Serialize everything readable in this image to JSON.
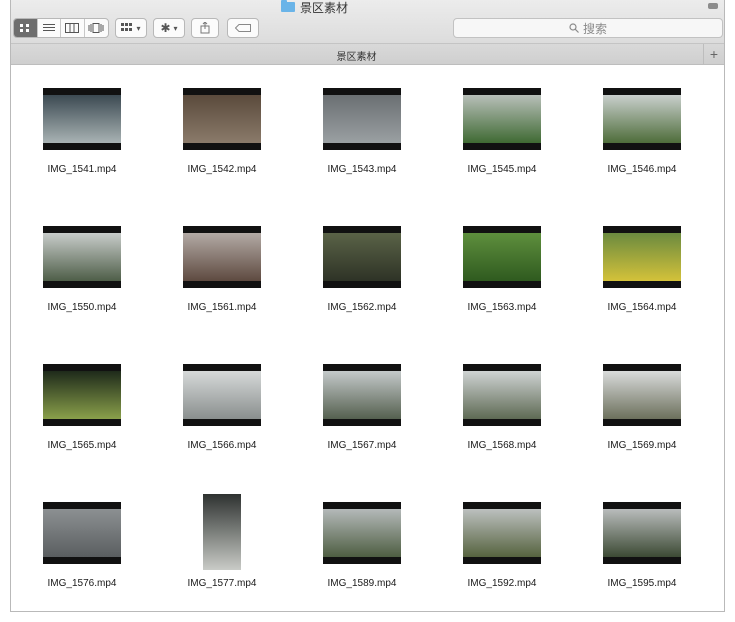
{
  "window": {
    "title": "景区素材",
    "tab_label": "景区素材",
    "search_placeholder": "搜索"
  },
  "toolbar": {
    "view_buttons": [
      "icon-view",
      "list-view",
      "column-view",
      "cover-flow-view"
    ],
    "arrange_icon": "grid-icon",
    "action_icon": "gear-icon",
    "share_icon": "share-icon",
    "tag_icon": "tag-icon"
  },
  "files": [
    {
      "name": "IMG_1541.mp4",
      "c1": "#3c4a52",
      "c2": "#a9b3b4",
      "shape": "wide"
    },
    {
      "name": "IMG_1542.mp4",
      "c1": "#5a4a3c",
      "c2": "#8a7a6a",
      "shape": "wide"
    },
    {
      "name": "IMG_1543.mp4",
      "c1": "#6a6f72",
      "c2": "#9aa0a2",
      "shape": "wide"
    },
    {
      "name": "IMG_1545.mp4",
      "c1": "#b8bfb9",
      "c2": "#3f6a33",
      "shape": "wide"
    },
    {
      "name": "IMG_1546.mp4",
      "c1": "#c9cfcd",
      "c2": "#4e6d3a",
      "shape": "wide"
    },
    {
      "name": "IMG_1550.mp4",
      "c1": "#c8ccca",
      "c2": "#4e5e48",
      "shape": "wide"
    },
    {
      "name": "IMG_1561.mp4",
      "c1": "#b3aaa5",
      "c2": "#5e4a40",
      "shape": "wide"
    },
    {
      "name": "IMG_1562.mp4",
      "c1": "#5a6347",
      "c2": "#2e3326",
      "shape": "wide"
    },
    {
      "name": "IMG_1563.mp4",
      "c1": "#5e8f3d",
      "c2": "#2f5a1f",
      "shape": "wide"
    },
    {
      "name": "IMG_1564.mp4",
      "c1": "#6b8a3f",
      "c2": "#d4c23a",
      "shape": "wide"
    },
    {
      "name": "IMG_1565.mp4",
      "c1": "#1e2a1a",
      "c2": "#8aa04a",
      "shape": "wide"
    },
    {
      "name": "IMG_1566.mp4",
      "c1": "#d6d9d9",
      "c2": "#8a8f8e",
      "shape": "wide"
    },
    {
      "name": "IMG_1567.mp4",
      "c1": "#c4c9ca",
      "c2": "#55604f",
      "shape": "wide"
    },
    {
      "name": "IMG_1568.mp4",
      "c1": "#cfd3d3",
      "c2": "#5e6a54",
      "shape": "wide"
    },
    {
      "name": "IMG_1569.mp4",
      "c1": "#d9dbdb",
      "c2": "#6c705c",
      "shape": "wide"
    },
    {
      "name": "IMG_1576.mp4",
      "c1": "#8c9092",
      "c2": "#5a5e60",
      "shape": "wide"
    },
    {
      "name": "IMG_1577.mp4",
      "c1": "#2e3230",
      "c2": "#c9cbc7",
      "shape": "tall"
    },
    {
      "name": "IMG_1589.mp4",
      "c1": "#b4b9b9",
      "c2": "#4e5e42",
      "shape": "wide"
    },
    {
      "name": "IMG_1592.mp4",
      "c1": "#bcc0bf",
      "c2": "#56633f",
      "shape": "wide"
    },
    {
      "name": "IMG_1595.mp4",
      "c1": "#b9bcbc",
      "c2": "#3c4a34",
      "shape": "wide"
    }
  ]
}
